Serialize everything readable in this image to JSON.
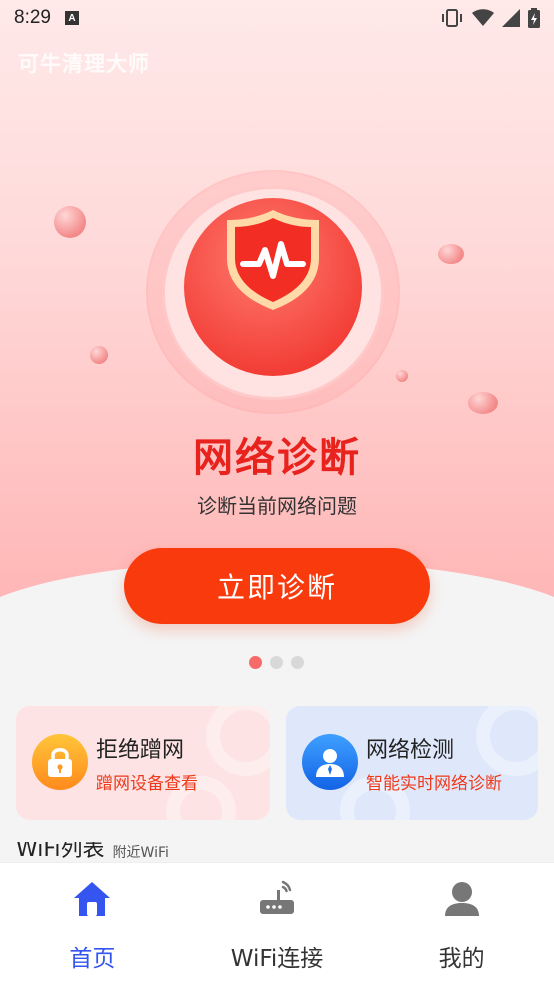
{
  "status_bar": {
    "time": "8:29",
    "notification_letter": "A"
  },
  "app": {
    "title": "可牛清理大师"
  },
  "hero": {
    "title": "网络诊断",
    "subtitle": "诊断当前网络问题",
    "button_label": "立即诊断"
  },
  "carousel": {
    "page_count": 3,
    "active_index": 0
  },
  "cards": [
    {
      "title": "拒绝蹭网",
      "desc": "蹭网设备查看",
      "icon": "lock-icon"
    },
    {
      "title": "网络检测",
      "desc": "智能实时网络诊断",
      "icon": "user-icon"
    }
  ],
  "wifi_list": {
    "title": "WiFi列表",
    "subtitle": "附近WiFi"
  },
  "nav": [
    {
      "label": "首页",
      "icon": "home-icon",
      "active": true
    },
    {
      "label": "WiFi连接",
      "icon": "router-icon",
      "active": false
    },
    {
      "label": "我的",
      "icon": "profile-icon",
      "active": false
    }
  ],
  "colors": {
    "accent": "#f83a0c",
    "nav_active": "#3455f0",
    "title_red": "#e8231e"
  }
}
